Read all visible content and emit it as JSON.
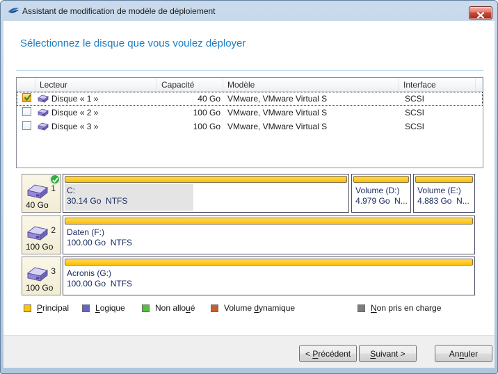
{
  "window": {
    "title": "Assistant de modification de modèle de déploiement"
  },
  "heading": "Sélectionnez le disque que vous voulez déployer",
  "disk_table": {
    "columns": {
      "drive": "Lecteur",
      "capacity": "Capacité",
      "model": "Modèle",
      "interface": "Interface"
    },
    "rows": [
      {
        "checked": true,
        "name": "Disque « 1 »",
        "capacity": "40 Go",
        "model": "VMware, VMware Virtual S",
        "interface": "SCSI"
      },
      {
        "checked": false,
        "name": "Disque « 2 »",
        "capacity": "100 Go",
        "model": "VMware, VMware Virtual S",
        "interface": "SCSI"
      },
      {
        "checked": false,
        "name": "Disque « 3 »",
        "capacity": "100 Go",
        "model": "VMware, VMware Virtual S",
        "interface": "SCSI"
      }
    ]
  },
  "disk_map": {
    "disks": [
      {
        "number": "1",
        "capacity": "40 Go",
        "selected": true,
        "volumes": [
          {
            "name": "C:",
            "size": "30.14 Go  NTFS",
            "width_pct": 69.5,
            "used_pct": 45
          },
          {
            "name": "Volume (D:)",
            "size": "4.979 Go  N...",
            "width_pct": 14.3
          },
          {
            "name": "Volume (E:)",
            "size": "4.883 Go  N...",
            "width_pct": 14.8
          }
        ]
      },
      {
        "number": "2",
        "capacity": "100 Go",
        "selected": false,
        "volumes": [
          {
            "name": "Daten (F:)",
            "size": "100.00 Go  NTFS",
            "width_pct": 100
          }
        ]
      },
      {
        "number": "3",
        "capacity": "100 Go",
        "selected": false,
        "volumes": [
          {
            "name": "Acronis (G:)",
            "size": "100.00 Go  NTFS",
            "width_pct": 100
          }
        ]
      }
    ],
    "partition_type_color": "#fcbf00"
  },
  "legend": {
    "items": [
      {
        "pre": "",
        "key": "P",
        "post": "rincipal",
        "color": "#ffc600"
      },
      {
        "pre": "",
        "key": "L",
        "post": "ogique",
        "color": "#6563cf"
      },
      {
        "pre": "Non allo",
        "key": "u",
        "post": "é",
        "color": "#4fc33c"
      },
      {
        "pre": "Volume ",
        "key": "d",
        "post": "ynamique",
        "color": "#cd5c2b"
      },
      {
        "pre": "",
        "key": "N",
        "post": "on pris en charge",
        "color": "#7d7d7d"
      }
    ]
  },
  "buttons": {
    "previous": {
      "pre": "< ",
      "key": "P",
      "post": "récédent"
    },
    "next": {
      "pre": "",
      "key": "S",
      "post": "uivant >"
    },
    "cancel": {
      "pre": "An",
      "key": "n",
      "post": "uler"
    }
  },
  "colors": {
    "titlebar": "#bcd0e6",
    "heading_text": "#1b7dc2",
    "primary_partition": "#fcbf00",
    "selected_badge": "#2fae3e",
    "close_button": "#c0392b"
  }
}
